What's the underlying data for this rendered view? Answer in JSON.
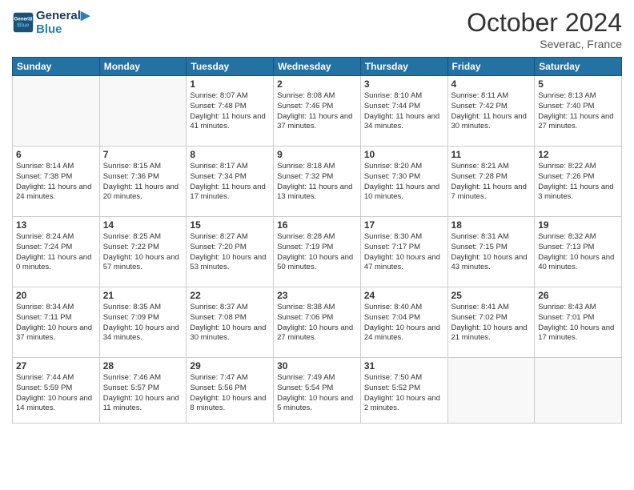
{
  "header": {
    "logo_line1": "General",
    "logo_line2": "Blue",
    "month": "October 2024",
    "location": "Severac, France"
  },
  "days_of_week": [
    "Sunday",
    "Monday",
    "Tuesday",
    "Wednesday",
    "Thursday",
    "Friday",
    "Saturday"
  ],
  "weeks": [
    [
      {
        "day": "",
        "sunrise": "",
        "sunset": "",
        "daylight": ""
      },
      {
        "day": "",
        "sunrise": "",
        "sunset": "",
        "daylight": ""
      },
      {
        "day": "1",
        "sunrise": "Sunrise: 8:07 AM",
        "sunset": "Sunset: 7:48 PM",
        "daylight": "Daylight: 11 hours and 41 minutes."
      },
      {
        "day": "2",
        "sunrise": "Sunrise: 8:08 AM",
        "sunset": "Sunset: 7:46 PM",
        "daylight": "Daylight: 11 hours and 37 minutes."
      },
      {
        "day": "3",
        "sunrise": "Sunrise: 8:10 AM",
        "sunset": "Sunset: 7:44 PM",
        "daylight": "Daylight: 11 hours and 34 minutes."
      },
      {
        "day": "4",
        "sunrise": "Sunrise: 8:11 AM",
        "sunset": "Sunset: 7:42 PM",
        "daylight": "Daylight: 11 hours and 30 minutes."
      },
      {
        "day": "5",
        "sunrise": "Sunrise: 8:13 AM",
        "sunset": "Sunset: 7:40 PM",
        "daylight": "Daylight: 11 hours and 27 minutes."
      }
    ],
    [
      {
        "day": "6",
        "sunrise": "Sunrise: 8:14 AM",
        "sunset": "Sunset: 7:38 PM",
        "daylight": "Daylight: 11 hours and 24 minutes."
      },
      {
        "day": "7",
        "sunrise": "Sunrise: 8:15 AM",
        "sunset": "Sunset: 7:36 PM",
        "daylight": "Daylight: 11 hours and 20 minutes."
      },
      {
        "day": "8",
        "sunrise": "Sunrise: 8:17 AM",
        "sunset": "Sunset: 7:34 PM",
        "daylight": "Daylight: 11 hours and 17 minutes."
      },
      {
        "day": "9",
        "sunrise": "Sunrise: 8:18 AM",
        "sunset": "Sunset: 7:32 PM",
        "daylight": "Daylight: 11 hours and 13 minutes."
      },
      {
        "day": "10",
        "sunrise": "Sunrise: 8:20 AM",
        "sunset": "Sunset: 7:30 PM",
        "daylight": "Daylight: 11 hours and 10 minutes."
      },
      {
        "day": "11",
        "sunrise": "Sunrise: 8:21 AM",
        "sunset": "Sunset: 7:28 PM",
        "daylight": "Daylight: 11 hours and 7 minutes."
      },
      {
        "day": "12",
        "sunrise": "Sunrise: 8:22 AM",
        "sunset": "Sunset: 7:26 PM",
        "daylight": "Daylight: 11 hours and 3 minutes."
      }
    ],
    [
      {
        "day": "13",
        "sunrise": "Sunrise: 8:24 AM",
        "sunset": "Sunset: 7:24 PM",
        "daylight": "Daylight: 11 hours and 0 minutes."
      },
      {
        "day": "14",
        "sunrise": "Sunrise: 8:25 AM",
        "sunset": "Sunset: 7:22 PM",
        "daylight": "Daylight: 10 hours and 57 minutes."
      },
      {
        "day": "15",
        "sunrise": "Sunrise: 8:27 AM",
        "sunset": "Sunset: 7:20 PM",
        "daylight": "Daylight: 10 hours and 53 minutes."
      },
      {
        "day": "16",
        "sunrise": "Sunrise: 8:28 AM",
        "sunset": "Sunset: 7:19 PM",
        "daylight": "Daylight: 10 hours and 50 minutes."
      },
      {
        "day": "17",
        "sunrise": "Sunrise: 8:30 AM",
        "sunset": "Sunset: 7:17 PM",
        "daylight": "Daylight: 10 hours and 47 minutes."
      },
      {
        "day": "18",
        "sunrise": "Sunrise: 8:31 AM",
        "sunset": "Sunset: 7:15 PM",
        "daylight": "Daylight: 10 hours and 43 minutes."
      },
      {
        "day": "19",
        "sunrise": "Sunrise: 8:32 AM",
        "sunset": "Sunset: 7:13 PM",
        "daylight": "Daylight: 10 hours and 40 minutes."
      }
    ],
    [
      {
        "day": "20",
        "sunrise": "Sunrise: 8:34 AM",
        "sunset": "Sunset: 7:11 PM",
        "daylight": "Daylight: 10 hours and 37 minutes."
      },
      {
        "day": "21",
        "sunrise": "Sunrise: 8:35 AM",
        "sunset": "Sunset: 7:09 PM",
        "daylight": "Daylight: 10 hours and 34 minutes."
      },
      {
        "day": "22",
        "sunrise": "Sunrise: 8:37 AM",
        "sunset": "Sunset: 7:08 PM",
        "daylight": "Daylight: 10 hours and 30 minutes."
      },
      {
        "day": "23",
        "sunrise": "Sunrise: 8:38 AM",
        "sunset": "Sunset: 7:06 PM",
        "daylight": "Daylight: 10 hours and 27 minutes."
      },
      {
        "day": "24",
        "sunrise": "Sunrise: 8:40 AM",
        "sunset": "Sunset: 7:04 PM",
        "daylight": "Daylight: 10 hours and 24 minutes."
      },
      {
        "day": "25",
        "sunrise": "Sunrise: 8:41 AM",
        "sunset": "Sunset: 7:02 PM",
        "daylight": "Daylight: 10 hours and 21 minutes."
      },
      {
        "day": "26",
        "sunrise": "Sunrise: 8:43 AM",
        "sunset": "Sunset: 7:01 PM",
        "daylight": "Daylight: 10 hours and 17 minutes."
      }
    ],
    [
      {
        "day": "27",
        "sunrise": "Sunrise: 7:44 AM",
        "sunset": "Sunset: 5:59 PM",
        "daylight": "Daylight: 10 hours and 14 minutes."
      },
      {
        "day": "28",
        "sunrise": "Sunrise: 7:46 AM",
        "sunset": "Sunset: 5:57 PM",
        "daylight": "Daylight: 10 hours and 11 minutes."
      },
      {
        "day": "29",
        "sunrise": "Sunrise: 7:47 AM",
        "sunset": "Sunset: 5:56 PM",
        "daylight": "Daylight: 10 hours and 8 minutes."
      },
      {
        "day": "30",
        "sunrise": "Sunrise: 7:49 AM",
        "sunset": "Sunset: 5:54 PM",
        "daylight": "Daylight: 10 hours and 5 minutes."
      },
      {
        "day": "31",
        "sunrise": "Sunrise: 7:50 AM",
        "sunset": "Sunset: 5:52 PM",
        "daylight": "Daylight: 10 hours and 2 minutes."
      },
      {
        "day": "",
        "sunrise": "",
        "sunset": "",
        "daylight": ""
      },
      {
        "day": "",
        "sunrise": "",
        "sunset": "",
        "daylight": ""
      }
    ]
  ]
}
